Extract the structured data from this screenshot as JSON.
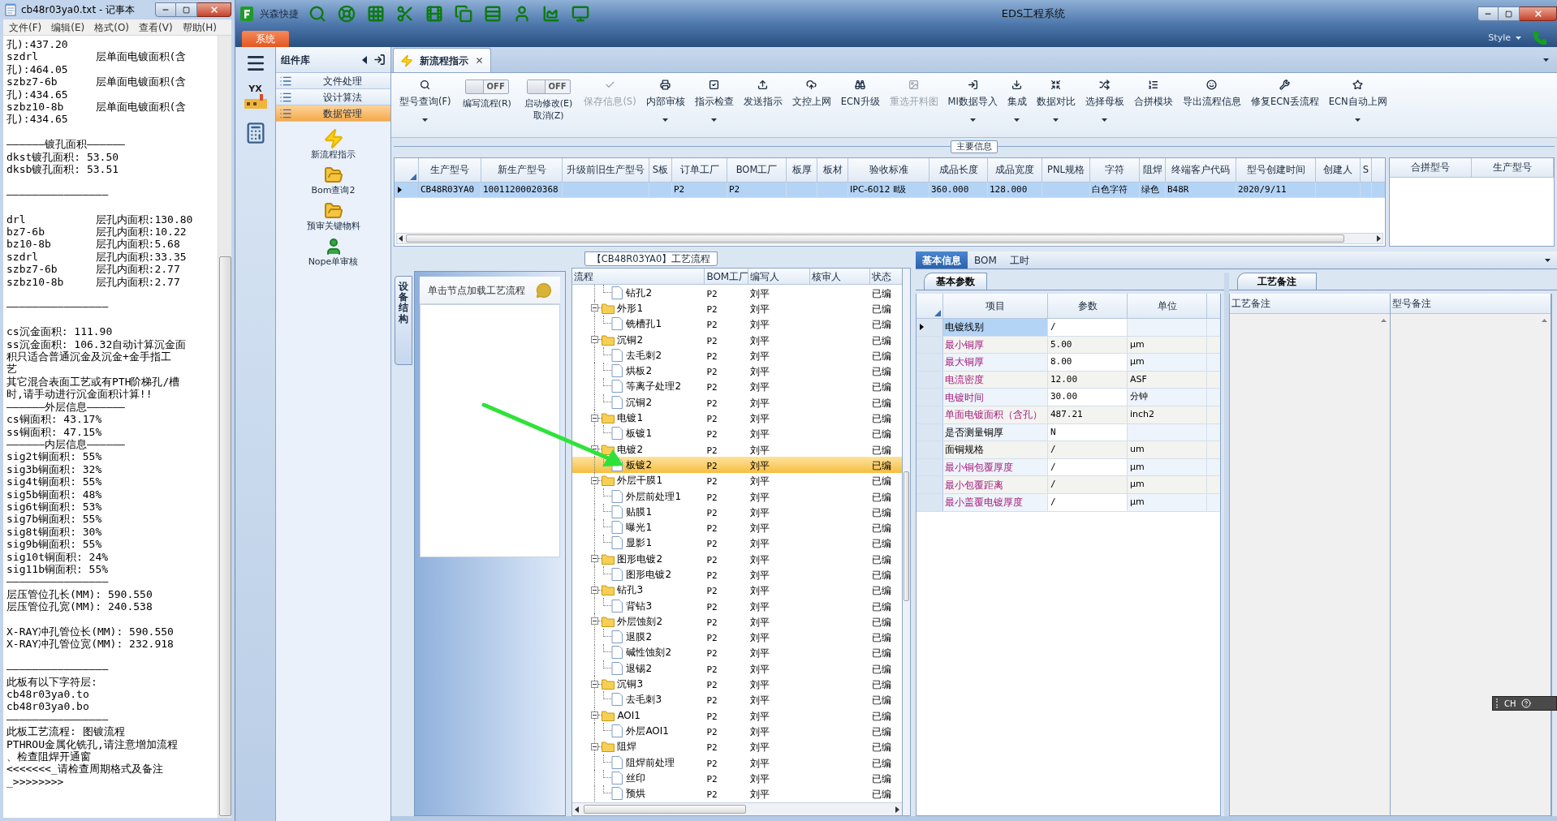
{
  "notepad": {
    "title": "cb48r03ya0.txt - 记事本",
    "menu": [
      "文件(F)",
      "编辑(E)",
      "格式(O)",
      "查看(V)",
      "帮助(H)"
    ],
    "paragraphs": [
      [
        "孔):437.20",
        "szdrl         层单面电镀面积(含",
        "孔):464.05",
        "szbz7-6b      层单面电镀面积(含",
        "孔):434.65",
        "szbz10-8b     层单面电镀面积(含",
        "孔):434.65"
      ],
      [
        "——————镀孔面积——————",
        "dkst镀孔面积: 53.50",
        "dksb镀孔面积: 53.51"
      ],
      [
        "————————————————"
      ],
      [
        "drl           层孔内面积:130.80",
        "bz7-6b        层孔内面积:10.22",
        "bz10-8b       层孔内面积:5.68",
        "szdrl         层孔内面积:33.35",
        "szbz7-6b      层孔内面积:2.77",
        "szbz10-8b     层孔内面积:2.77"
      ],
      [
        "————————————————"
      ],
      [
        "cs沉金面积: 111.90",
        "ss沉金面积: 106.32自动计算沉金面",
        "积只适合普通沉金及沉金+金手指工",
        "艺",
        "其它混合表面工艺或有PTH阶梯孔/槽",
        "时,请手动进行沉金面积计算!!",
        "——————外层信息——————",
        "cs铜面积: 43.17%",
        "ss铜面积: 47.15%",
        "——————内层信息——————",
        "sig2t铜面积: 55%",
        "sig3b铜面积: 32%",
        "sig4t铜面积: 55%",
        "sig5b铜面积: 48%",
        "sig6t铜面积: 53%",
        "sig7b铜面积: 55%",
        "sig8t铜面积: 30%",
        "sig9b铜面积: 55%",
        "sig10t铜面积: 24%",
        "sig11b铜面积: 55%",
        "————————————————",
        "层压管位孔长(MM): 590.550",
        "层压管位孔宽(MM): 240.538"
      ],
      [
        "X-RAY冲孔管位长(MM): 590.550",
        "X-RAY冲孔管位宽(MM): 232.918"
      ],
      [
        "————————————————",
        "此板有以下字符层:",
        "cb48r03ya0.to",
        "cb48r03ya0.bo",
        "————————————————",
        "此板工艺流程: 图镀流程",
        "PTHROU金属化铣孔,请注意增加流程",
        "、检查阻焊开通窗",
        "<<<<<<<_请检查周期格式及备注",
        "_>>>>>>>>"
      ]
    ]
  },
  "app": {
    "title": "EDS工程系统",
    "quick_access_label": "兴森快捷",
    "system_tab": "系统",
    "style_label": "Style",
    "nav_logo_text": "YX"
  },
  "component_library": {
    "title": "组件库",
    "categories": [
      {
        "label": "文件处理",
        "selected": false
      },
      {
        "label": "设计算法",
        "selected": false
      },
      {
        "label": "数据管理",
        "selected": true
      }
    ],
    "tools": [
      {
        "label": "新流程指示",
        "kind": "lightning"
      },
      {
        "label": "Bom查询2",
        "kind": "folder"
      },
      {
        "label": "预审关键物料",
        "kind": "folder"
      },
      {
        "label": "Nope单审核",
        "kind": "person"
      }
    ]
  },
  "document_tab": {
    "label": "新流程指示"
  },
  "ribbon": [
    {
      "kind": "button",
      "label": "型号查询(F)",
      "disabled": false,
      "dropdown": true
    },
    {
      "kind": "toggle",
      "label": "编写流程(R)",
      "toggle_text": "OFF",
      "on": false
    },
    {
      "kind": "toggle",
      "label": "启动修改(E)\n取消(Z)",
      "toggle_text": "OFF",
      "on": false
    },
    {
      "kind": "button",
      "label": "保存信息(S)",
      "disabled": true,
      "dropdown": false
    },
    {
      "kind": "button",
      "label": "内部审核",
      "disabled": false,
      "dropdown": true
    },
    {
      "kind": "button",
      "label": "指示检查",
      "disabled": false,
      "dropdown": true
    },
    {
      "kind": "button",
      "label": "发送指示",
      "disabled": false,
      "dropdown": false
    },
    {
      "kind": "button",
      "label": "文控上网",
      "disabled": false,
      "dropdown": false
    },
    {
      "kind": "button",
      "label": "ECN升级",
      "disabled": false,
      "dropdown": false
    },
    {
      "kind": "button",
      "label": "重选开料图",
      "disabled": true,
      "dropdown": false
    },
    {
      "kind": "button",
      "label": "MI数据导入",
      "disabled": false,
      "dropdown": true
    },
    {
      "kind": "button",
      "label": "集成",
      "disabled": false,
      "dropdown": true
    },
    {
      "kind": "button",
      "label": "数据对比",
      "disabled": false,
      "dropdown": true
    },
    {
      "kind": "button",
      "label": "选择母板",
      "disabled": false,
      "dropdown": true
    },
    {
      "kind": "button",
      "label": "合拼模块",
      "disabled": false,
      "dropdown": false
    },
    {
      "kind": "button",
      "label": "导出流程信息",
      "disabled": false,
      "dropdown": false
    },
    {
      "kind": "button",
      "label": "修复ECN丢流程",
      "disabled": false,
      "dropdown": false
    },
    {
      "kind": "button",
      "label": "ECN自动上网",
      "disabled": false,
      "dropdown": true
    }
  ],
  "main_info": {
    "caption": "主要信息",
    "columns": [
      "生产型号",
      "新生产型号",
      "升级前旧生产型号",
      "S板",
      "订单工厂",
      "BOM工厂",
      "板厚",
      "板材",
      "验收标准",
      "成品长度",
      "成品宽度",
      "PNL规格",
      "字符",
      "阻焊",
      "终端客户代码",
      "型号创建时间",
      "创建人",
      "S"
    ],
    "rows": [
      {
        "selected": true,
        "cells": [
          "CB48R03YA0",
          "10011200020368",
          null,
          null,
          "P2",
          "P2",
          null,
          null,
          "IPC-6012 Ⅱ级",
          "360.000",
          "128.000",
          null,
          "白色字符",
          "绿色",
          "B48R",
          "2020/9/11",
          null,
          null
        ]
      }
    ],
    "side_columns": [
      "合拼型号",
      "生产型号"
    ]
  },
  "process": {
    "caption": "【CB48R03YA0】工艺流程",
    "side_tab": "设备结构",
    "hint": "单击节点加载工艺流程",
    "columns": [
      "流程",
      "BOM工厂",
      "编写人",
      "核审人",
      "状态"
    ],
    "tree": [
      {
        "children": [
          {
            "label": "钻孔2",
            "factory": "P2",
            "author": "刘平",
            "status": "已编",
            "selected": false
          }
        ]
      },
      {
        "label": "外形1",
        "factory": "P2",
        "author": "刘平",
        "status": "已编",
        "selected": false,
        "expanded": true,
        "children": [
          {
            "label": "铣槽孔1",
            "factory": "P2",
            "author": "刘平",
            "status": "已编",
            "selected": false
          }
        ]
      },
      {
        "label": "沉铜2",
        "factory": "P2",
        "author": "刘平",
        "status": "已编",
        "selected": false,
        "expanded": true,
        "children": [
          {
            "label": "去毛刺2",
            "factory": "P2",
            "author": "刘平",
            "status": "已编",
            "selected": false
          },
          {
            "label": "烘板2",
            "factory": "P2",
            "author": "刘平",
            "status": "已编",
            "selected": false
          },
          {
            "label": "等离子处理2",
            "factory": "P2",
            "author": "刘平",
            "status": "已编",
            "selected": false
          },
          {
            "label": "沉铜2",
            "factory": "P2",
            "author": "刘平",
            "status": "已编",
            "selected": false
          }
        ]
      },
      {
        "label": "电镀1",
        "factory": "P2",
        "author": "刘平",
        "status": "已编",
        "selected": false,
        "expanded": true,
        "children": [
          {
            "label": "板镀1",
            "factory": "P2",
            "author": "刘平",
            "status": "已编",
            "selected": false
          }
        ]
      },
      {
        "label": "电镀2",
        "factory": "P2",
        "author": "刘平",
        "status": "已编",
        "selected": false,
        "expanded": true,
        "children": [
          {
            "label": "板镀2",
            "factory": "P2",
            "author": "刘平",
            "status": "已编",
            "selected": true
          }
        ]
      },
      {
        "label": "外层干膜1",
        "factory": "P2",
        "author": "刘平",
        "status": "已编",
        "selected": false,
        "expanded": true,
        "children": [
          {
            "label": "外层前处理1",
            "factory": "P2",
            "author": "刘平",
            "status": "已编",
            "selected": false
          },
          {
            "label": "贴膜1",
            "factory": "P2",
            "author": "刘平",
            "status": "已编",
            "selected": false
          },
          {
            "label": "曝光1",
            "factory": "P2",
            "author": "刘平",
            "status": "已编",
            "selected": false
          },
          {
            "label": "显影1",
            "factory": "P2",
            "author": "刘平",
            "status": "已编",
            "selected": false
          }
        ]
      },
      {
        "label": "图形电镀2",
        "factory": "P2",
        "author": "刘平",
        "status": "已编",
        "selected": false,
        "expanded": true,
        "children": [
          {
            "label": "图形电镀2",
            "factory": "P2",
            "author": "刘平",
            "status": "已编",
            "selected": false
          }
        ]
      },
      {
        "label": "钻孔3",
        "factory": "P2",
        "author": "刘平",
        "status": "已编",
        "selected": false,
        "expanded": true,
        "children": [
          {
            "label": "背钻3",
            "factory": "P2",
            "author": "刘平",
            "status": "已编",
            "selected": false
          }
        ]
      },
      {
        "label": "外层蚀刻2",
        "factory": "P2",
        "author": "刘平",
        "status": "已编",
        "selected": false,
        "expanded": true,
        "children": [
          {
            "label": "退膜2",
            "factory": "P2",
            "author": "刘平",
            "status": "已编",
            "selected": false
          },
          {
            "label": "碱性蚀刻2",
            "factory": "P2",
            "author": "刘平",
            "status": "已编",
            "selected": false
          },
          {
            "label": "退锡2",
            "factory": "P2",
            "author": "刘平",
            "status": "已编",
            "selected": false
          }
        ]
      },
      {
        "label": "沉铜3",
        "factory": "P2",
        "author": "刘平",
        "status": "已编",
        "selected": false,
        "expanded": true,
        "children": [
          {
            "label": "去毛刺3",
            "factory": "P2",
            "author": "刘平",
            "status": "已编",
            "selected": false
          }
        ]
      },
      {
        "label": "AOI1",
        "factory": "P2",
        "author": "刘平",
        "status": "已编",
        "selected": false,
        "expanded": true,
        "children": [
          {
            "label": "外层AOI1",
            "factory": "P2",
            "author": "刘平",
            "status": "已编",
            "selected": false
          }
        ]
      },
      {
        "label": "阻焊",
        "factory": "P2",
        "author": "刘平",
        "status": "已编",
        "selected": false,
        "expanded": true,
        "children": [
          {
            "label": "阻焊前处理",
            "factory": "P2",
            "author": "刘平",
            "status": "已编",
            "selected": false
          },
          {
            "label": "丝印",
            "factory": "P2",
            "author": "刘平",
            "status": "已编",
            "selected": false
          },
          {
            "label": "预烘",
            "factory": "P2",
            "author": "刘平",
            "status": "已编",
            "selected": false
          }
        ]
      }
    ]
  },
  "detail": {
    "tabs": [
      {
        "label": "基本信息",
        "selected": true
      },
      {
        "label": "BOM",
        "selected": false
      },
      {
        "label": "工时",
        "selected": false
      }
    ],
    "params_tab": "基本参数",
    "columns": [
      "项目",
      "参数",
      "单位"
    ],
    "rows": [
      {
        "item": "电镀线别",
        "value": "/",
        "required": false,
        "current": true
      },
      {
        "item": "最小铜厚",
        "value": "5.00",
        "unit": "μm",
        "required": true,
        "current": false
      },
      {
        "item": "最大铜厚",
        "value": "8.00",
        "unit": "μm",
        "required": true,
        "current": false
      },
      {
        "item": "电流密度",
        "value": "12.00",
        "unit": "ASF",
        "required": true,
        "current": false
      },
      {
        "item": "电镀时间",
        "value": "30.00",
        "unit": "分钟",
        "required": true,
        "current": false
      },
      {
        "item": "单面电镀面积（含孔）",
        "value": "487.21",
        "unit": "inch2",
        "required": true,
        "current": false
      },
      {
        "item": "是否测量铜厚",
        "value": "N",
        "required": false,
        "current": false
      },
      {
        "item": "面铜规格",
        "value": "/",
        "unit": "um",
        "required": false,
        "current": false
      },
      {
        "item": "最小铜包覆厚度",
        "value": "/",
        "unit": "μm",
        "required": true,
        "current": false
      },
      {
        "item": "最小包覆距离",
        "value": "/",
        "unit": "μm",
        "required": true,
        "current": false
      },
      {
        "item": "最小盖覆电镀厚度",
        "value": "/",
        "unit": "μm",
        "required": true,
        "current": false
      }
    ],
    "notes_tab": "工艺备注",
    "notes_columns": [
      "工艺备注",
      "型号备注"
    ]
  },
  "language_bar": {
    "language": "CH"
  }
}
